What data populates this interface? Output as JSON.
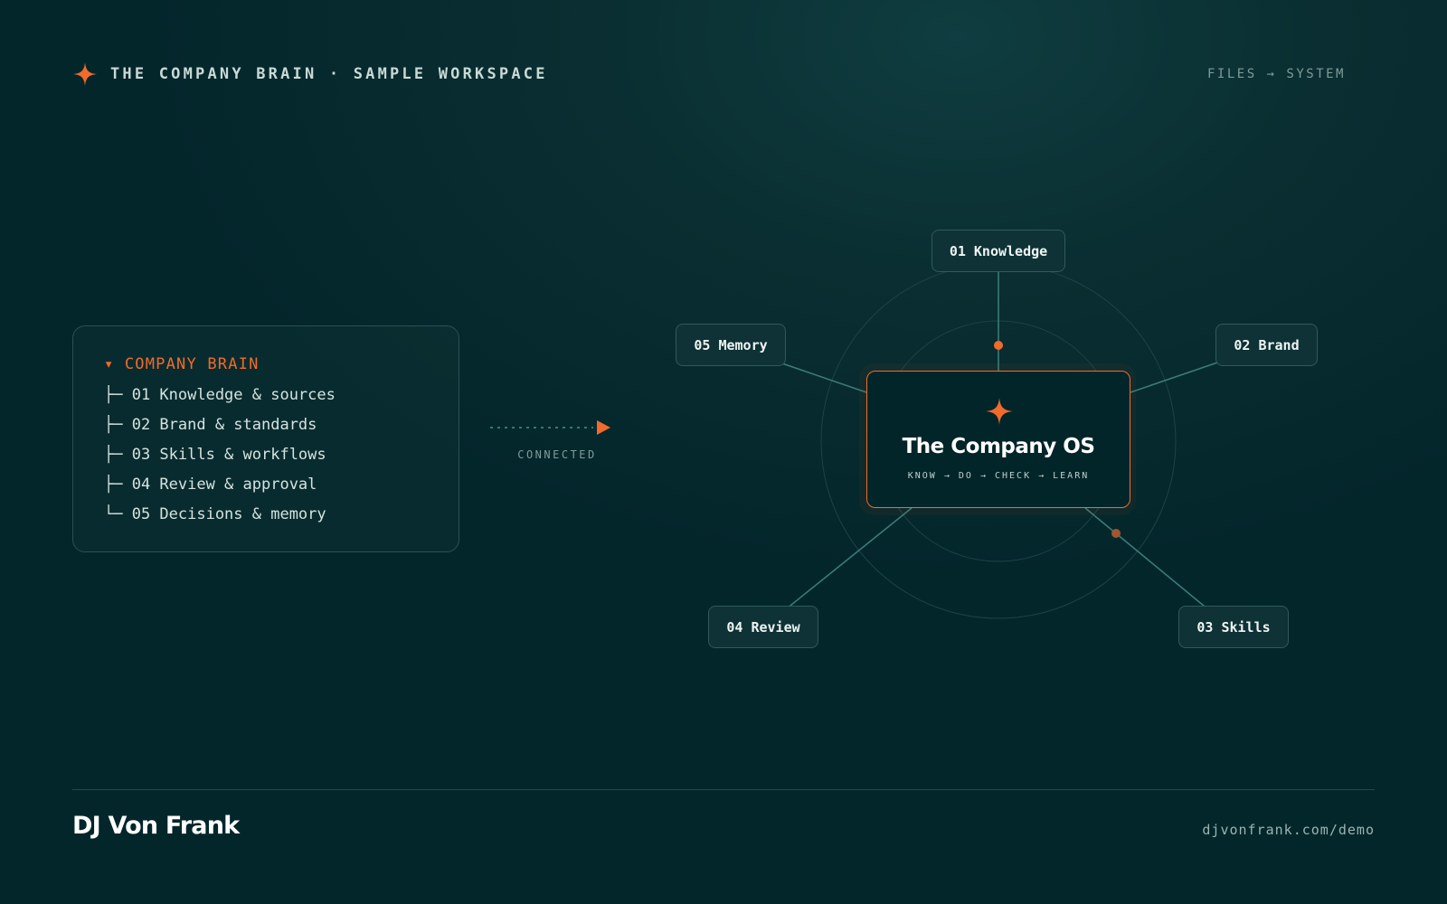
{
  "header": {
    "brand": "THE COMPANY BRAIN · SAMPLE WORKSPACE",
    "right_label": "FILES → SYSTEM",
    "brand_icon": "sparkle-icon"
  },
  "tree": {
    "root": "▾ COMPANY BRAIN",
    "items": [
      "├─ 01 Knowledge & sources",
      "├─ 02 Brand & standards",
      "├─ 03 Skills & workflows",
      "├─ 04 Review & approval",
      "└─ 05 Decisions & memory"
    ]
  },
  "connector": {
    "label": "CONNECTED"
  },
  "center": {
    "title": "The Company OS",
    "subtitle": "KNOW → DO → CHECK → LEARN",
    "icon": "sparkle-icon"
  },
  "nodes": {
    "knowledge": "01 Knowledge",
    "brand": "02 Brand",
    "skills": "03 Skills",
    "review": "04 Review",
    "memory": "05 Memory"
  },
  "footer": {
    "name": "DJ Von Frank",
    "url": "djvonfrank.com/demo"
  },
  "colors": {
    "accent": "#f26b2a",
    "background": "#03262b",
    "line": "#3c7a78"
  }
}
